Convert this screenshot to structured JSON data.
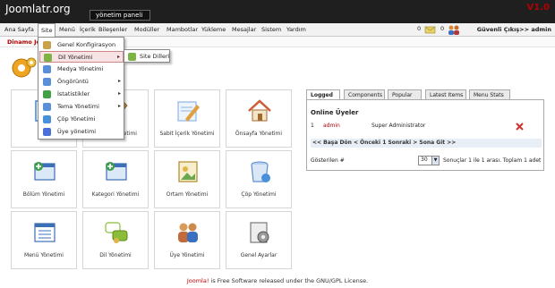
{
  "header": {
    "logo": "Joomlatr.org",
    "panel_title": "yönetim paneli",
    "version": "V1.0"
  },
  "menubar": {
    "items": [
      "Ana Sayfa",
      "Site",
      "Menü",
      "İçerik",
      "Bileşenler",
      "Modüller",
      "Mambotlar",
      "Yükleme",
      "Mesajlar",
      "Sistem",
      "Yardım"
    ],
    "active": "Site",
    "message_count": "0",
    "user_count": "0",
    "logout": "Güvenli Çıkış>> admin"
  },
  "sitebar": {
    "site_name": "Dinamo Jo"
  },
  "site_menu": {
    "items": [
      {
        "label": "Genel Konfigirasyon",
        "icon_color": "#c8a24a"
      },
      {
        "label": "Dil Yönetimi",
        "icon_color": "#7cb342",
        "has_sub": true
      },
      {
        "label": "Medya Yönetimi",
        "icon_color": "#5a8fd8"
      },
      {
        "label": "Öngörüntü",
        "icon_color": "#5a8fd8",
        "has_sub": true
      },
      {
        "label": "İstatistikler",
        "icon_color": "#43a047",
        "has_sub": true
      },
      {
        "label": "Tema Yönetimi",
        "icon_color": "#5a8fd8",
        "has_sub": true
      },
      {
        "label": "Çöp Yönetimi",
        "icon_color": "#4a90d9"
      },
      {
        "label": "Üye yönetimi",
        "icon_color": "#4a6fd9"
      }
    ],
    "submenu_items": [
      "Site Dilleri"
    ],
    "sub_arrow": "▸"
  },
  "tiles": [
    {
      "label": "Ye...",
      "icon": "add-content-icon",
      "color": "#3f7fd6"
    },
    {
      "label": "...çerik Yönetimi",
      "icon": "content-icon",
      "color": "#d28a3a"
    },
    {
      "label": "Sabit İçerik Yönetimi",
      "icon": "static-content-icon",
      "color": "#8fb6e8"
    },
    {
      "label": "Önsayfa Yönetimi",
      "icon": "frontpage-icon",
      "color": "#cf5a35"
    },
    {
      "label": "Bölüm Yönetimi",
      "icon": "section-icon",
      "color": "#3f9a4b"
    },
    {
      "label": "Kategori Yönetimi",
      "icon": "category-icon",
      "color": "#3f9a4b"
    },
    {
      "label": "Ortam Yönetimi",
      "icon": "media-icon",
      "color": "#e0b54a"
    },
    {
      "label": "Çöp Yönetimi",
      "icon": "trash-icon",
      "color": "#5b8fd0"
    },
    {
      "label": "Menü Yönetimi",
      "icon": "menu-icon",
      "color": "#3d6fb6"
    },
    {
      "label": "Dil Yönetimi",
      "icon": "language-icon",
      "color": "#8bbd3a"
    },
    {
      "label": "Üye Yönetimi",
      "icon": "users-icon",
      "color": "#c26a3a"
    },
    {
      "label": "Genel Ayarlar",
      "icon": "settings-icon",
      "color": "#7a7a7a"
    }
  ],
  "tabs": [
    "Logged",
    "Components",
    "Popular",
    "Latest Items",
    "Menu Stats"
  ],
  "active_tab": "Logged",
  "online": {
    "title": "Online Üyeler",
    "row": {
      "num": "1",
      "user": "admin",
      "role": "Super Administrator"
    },
    "pager": "<< Başa Dön < Önceki 1 Sonraki > Sona Git >>",
    "display_label": "Gösterilen #",
    "display_value": "30",
    "results": "Sonuçlar 1 ile 1 arası. Toplam 1 adet"
  },
  "footer": {
    "brand": "Joomla!",
    "text": " is Free Software released under the GNU/GPL License."
  }
}
